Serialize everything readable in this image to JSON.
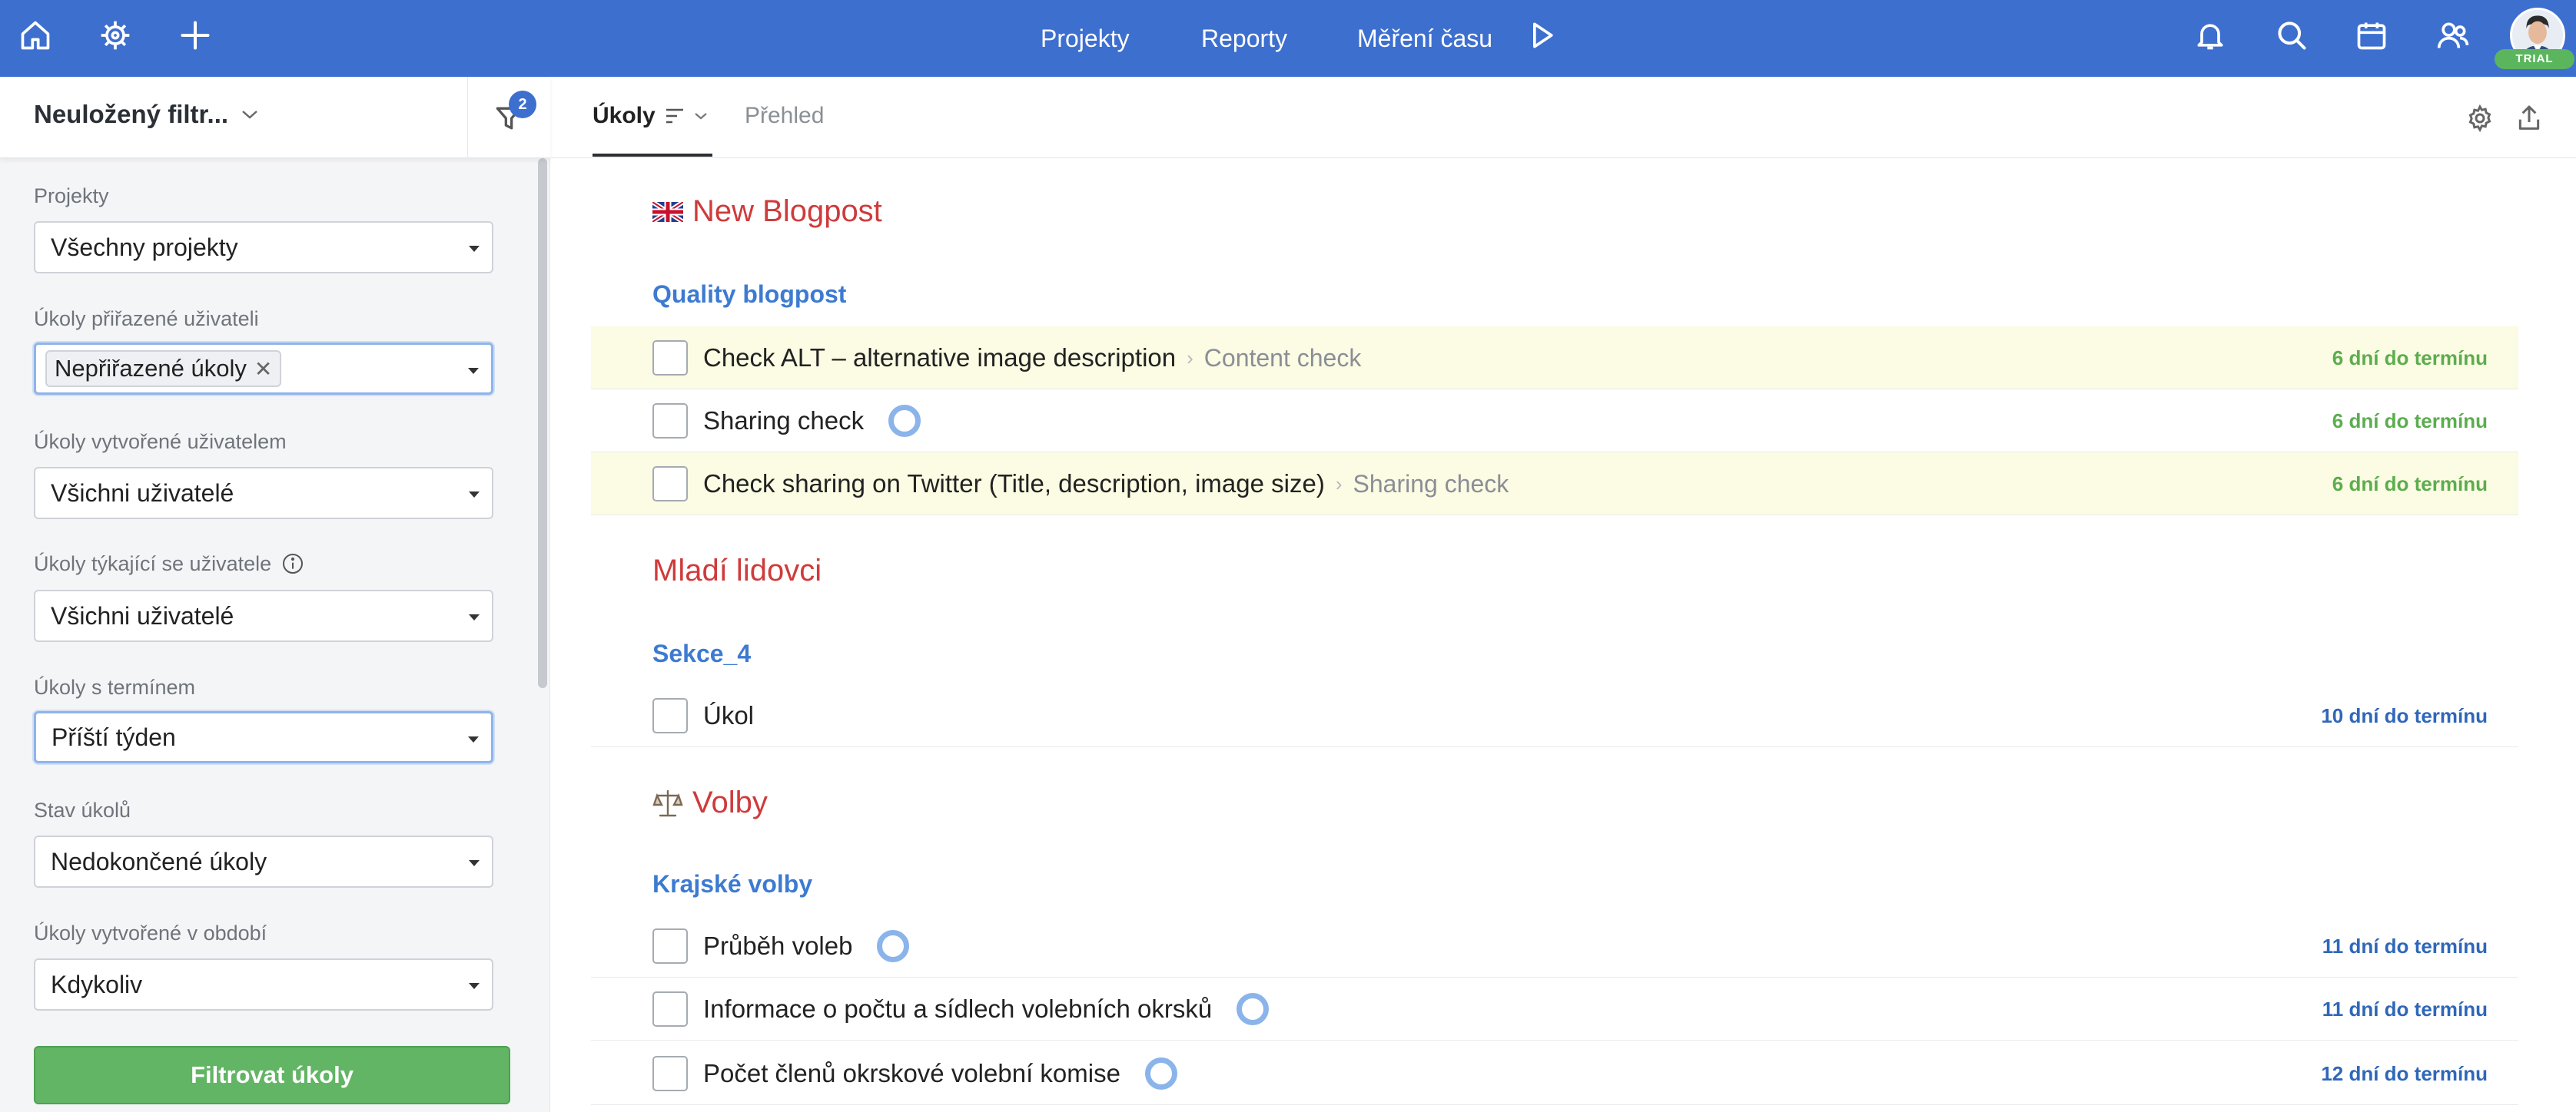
{
  "colors": {
    "topbar": "#3d6fcf",
    "project_title": "#cf3b3b",
    "section_title": "#3d7bd1",
    "due_green": "#5cad4f",
    "due_blue": "#2f67b9",
    "highlight_row": "#fcfbe3",
    "filter_button": "#62b564"
  },
  "topbar": {
    "left_icons": [
      "home-icon",
      "settings-wheel-icon",
      "plus-icon"
    ],
    "nav": [
      "Projekty",
      "Reporty",
      "Měření času"
    ],
    "play_icon": "play-icon",
    "right_icons": [
      "bell-icon",
      "search-icon",
      "calendar-icon",
      "users-icon"
    ],
    "trial_label": "TRIAL"
  },
  "filter_panel": {
    "name": "Neuložený filtr...",
    "badge_count": "2",
    "fields": [
      {
        "label": "Projekty",
        "value": "Všechny projekty"
      },
      {
        "label": "Úkoly přiřazené uživateli",
        "value": "Nepřiřazené úkoly"
      },
      {
        "label": "Úkoly vytvořené uživatelem",
        "value": "Všichni uživatelé"
      },
      {
        "label": "Úkoly týkající se uživatele",
        "value": "Všichni uživatelé"
      },
      {
        "label": "Úkoly s termínem",
        "value": "Příští týden"
      },
      {
        "label": "Stav úkolů",
        "value": "Nedokončené úkoly"
      },
      {
        "label": "Úkoly vytvořené v období",
        "value": "Kdykoliv"
      }
    ],
    "submit_label": "Filtrovat úkoly"
  },
  "tabs": [
    {
      "label": "Úkoly",
      "active": true
    },
    {
      "label": "Přehled",
      "active": false
    }
  ],
  "groups": [
    {
      "project": "New Blogpost",
      "project_icon": "uk-flag-icon",
      "section": "Quality blogpost",
      "tasks": [
        {
          "title": "Check ALT – alternative image description",
          "parent": "Content check",
          "due": "6 dní do termínu"
        },
        {
          "title": "Sharing check",
          "due": "6 dní do termínu"
        },
        {
          "title": "Check sharing on Twitter (Title, description, image size)",
          "parent": "Sharing check",
          "due": "6 dní do termínu"
        }
      ]
    },
    {
      "project": "Mladí lidovci",
      "section": "Sekce_4",
      "tasks": [
        {
          "title": "Úkol",
          "due": "10 dní do termínu"
        }
      ]
    },
    {
      "project": "Volby",
      "project_icon": "scales-icon",
      "section": "Krajské volby",
      "tasks": [
        {
          "title": "Průběh voleb",
          "due": "11 dní do termínu"
        },
        {
          "title": "Informace o počtu a sídlech volebních okrsků",
          "due": "11 dní do termínu"
        },
        {
          "title": "Počet členů okrskové volební komise",
          "due": "12 dní do termínu"
        }
      ]
    }
  ]
}
